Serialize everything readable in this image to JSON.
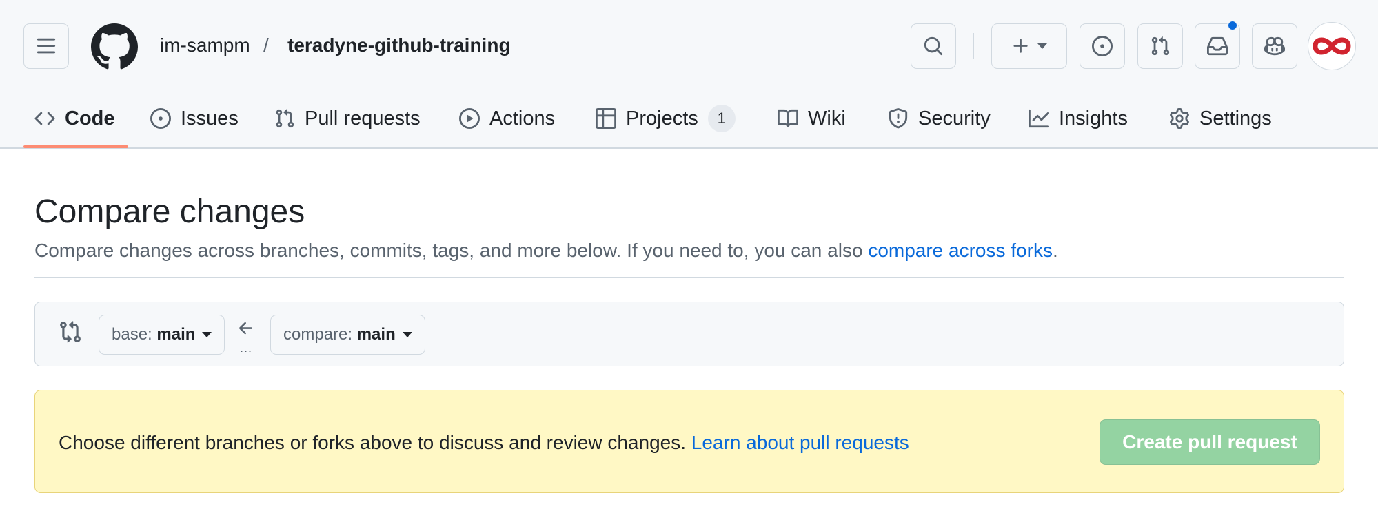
{
  "header": {
    "owner": "im-sampm",
    "separator": "/",
    "repo": "teradyne-github-training",
    "icons": [
      "hamburger-menu-icon",
      "github-logo-icon",
      "search-icon",
      "plus-icon",
      "issue-icon",
      "pull-request-icon",
      "inbox-icon",
      "copilot-icon"
    ],
    "notification_dot_color": "#0969da",
    "avatar_color": "#d1242f"
  },
  "tabs": [
    {
      "label": "Code",
      "icon": "code-icon",
      "selected": true
    },
    {
      "label": "Issues",
      "icon": "issue-opened-icon"
    },
    {
      "label": "Pull requests",
      "icon": "git-pull-request-icon"
    },
    {
      "label": "Actions",
      "icon": "play-icon"
    },
    {
      "label": "Projects",
      "icon": "table-icon",
      "counter": "1"
    },
    {
      "label": "Wiki",
      "icon": "book-icon"
    },
    {
      "label": "Security",
      "icon": "shield-icon"
    },
    {
      "label": "Insights",
      "icon": "graph-icon"
    },
    {
      "label": "Settings",
      "icon": "gear-icon"
    }
  ],
  "main": {
    "title": "Compare changes",
    "subtitle": "Compare changes across branches, commits, tags, and more below. If you need to, you can also ",
    "subtitle_link": "compare across forks",
    "subtitle_end": ".",
    "range": {
      "base_label": "base: ",
      "base_value": "main",
      "compare_label": "compare: ",
      "compare_value": "main",
      "dots": "..."
    },
    "flash": {
      "text": "Choose different branches or forks above to discuss and review changes. ",
      "link": "Learn about pull requests",
      "button": "Create pull request",
      "background": "#fff8c5",
      "button_color": "#94d3a2"
    }
  }
}
